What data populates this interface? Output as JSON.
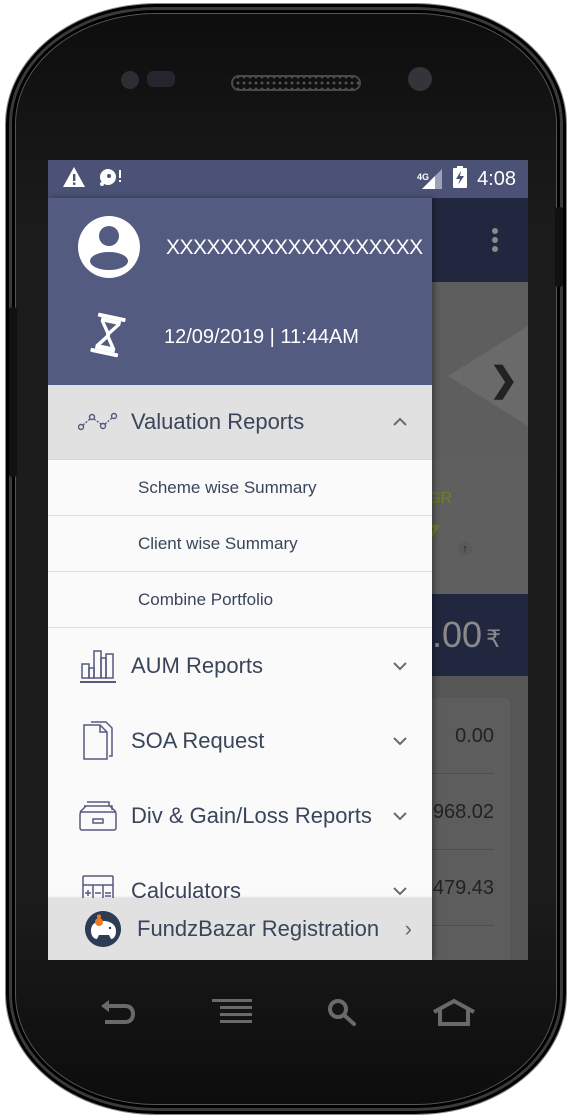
{
  "status_bar": {
    "left_icons": [
      "warning-icon",
      "sync-problem-icon"
    ],
    "network": "4G",
    "time": "4:08"
  },
  "drawer": {
    "user_name": "XXXXXXXXXXXXXXXXXXX",
    "last_login": "12/09/2019 | 11:44AM",
    "menu": [
      {
        "label": "Valuation Reports",
        "icon": "line-chart-icon",
        "expanded": true,
        "sub_items": [
          {
            "label": "Scheme wise Summary"
          },
          {
            "label": "Client wise Summary"
          },
          {
            "label": "Combine Portfolio"
          }
        ]
      },
      {
        "label": "AUM Reports",
        "icon": "bar-chart-icon",
        "expanded": false
      },
      {
        "label": "SOA Request",
        "icon": "documents-icon",
        "expanded": false
      },
      {
        "label": "Div & Gain/Loss Reports",
        "icon": "tray-icon",
        "expanded": false
      },
      {
        "label": "Calculators",
        "icon": "calculator-icon",
        "expanded": false
      }
    ],
    "footer": {
      "label": "FundzBazar Registration",
      "icon": "fundzbazar-logo"
    }
  },
  "background_app": {
    "cagr_label": "GR",
    "cagr_value": "7",
    "total_value": ".00",
    "currency": "₹",
    "rows": [
      "0.00",
      ",968.02",
      "479.43"
    ]
  },
  "hardware_nav": [
    "back",
    "menu",
    "search",
    "home"
  ],
  "colors": {
    "drawer_header": "#545b80",
    "status_bar": "#4b5275",
    "menu_text": "#39455a",
    "expanded_bg": "#e1e1e1",
    "cagr_green": "#6f7f22"
  }
}
